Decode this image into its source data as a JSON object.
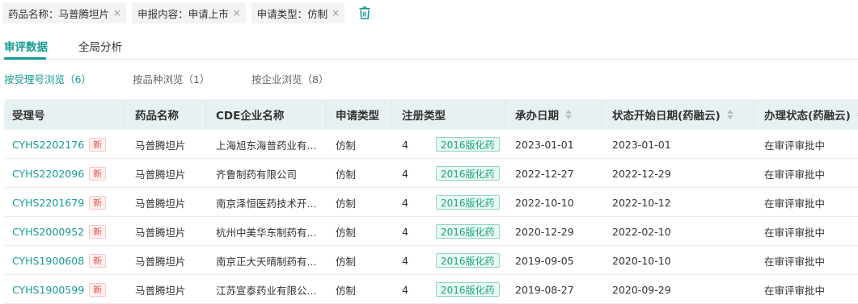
{
  "filters": [
    {
      "label": "药品名称：马普腾坦片"
    },
    {
      "label": "申报内容：申请上市"
    },
    {
      "label": "申请类型：仿制"
    }
  ],
  "icons": {
    "close": "×",
    "trash": "trash-icon",
    "sort": "sort-icon"
  },
  "tabs": [
    {
      "label": "审评数据",
      "active": true
    },
    {
      "label": "全局分析",
      "active": false
    }
  ],
  "subtabs": [
    {
      "label": "按受理号浏览（6）",
      "active": true
    },
    {
      "label": "按品种浏览（1）",
      "active": false
    },
    {
      "label": "按企业浏览（8）",
      "active": false
    }
  ],
  "table": {
    "headers": [
      "受理号",
      "药品名称",
      "CDE企业名称",
      "申请类型",
      "注册类型",
      "承办日期",
      "状态开始日期(药融云)",
      "办理状态(药融云)"
    ],
    "new_badge": "新",
    "rows": [
      {
        "id": "CYHS2202176",
        "drug": "马普腾坦片",
        "company": "上海旭东海普药业有...",
        "apply_type": "仿制",
        "reg_num": "4",
        "reg_badge": "2016版化药",
        "accept_date": "2023-01-01",
        "status_date": "2023-01-01",
        "status": "在审评审批中"
      },
      {
        "id": "CYHS2202096",
        "drug": "马普腾坦片",
        "company": "齐鲁制药有限公司",
        "apply_type": "仿制",
        "reg_num": "4",
        "reg_badge": "2016版化药",
        "accept_date": "2022-12-27",
        "status_date": "2022-12-29",
        "status": "在审评审批中"
      },
      {
        "id": "CYHS2201679",
        "drug": "马普腾坦片",
        "company": "南京泽恒医药技术开...",
        "apply_type": "仿制",
        "reg_num": "4",
        "reg_badge": "2016版化药",
        "accept_date": "2022-10-10",
        "status_date": "2022-10-12",
        "status": "在审评审批中"
      },
      {
        "id": "CYHS2000952",
        "drug": "马普腾坦片",
        "company": "杭州中美华东制药有...",
        "apply_type": "仿制",
        "reg_num": "4",
        "reg_badge": "2016版化药",
        "accept_date": "2020-12-29",
        "status_date": "2022-02-10",
        "status": "在审评审批中"
      },
      {
        "id": "CYHS1900608",
        "drug": "马普腾坦片",
        "company": "南京正大天晴制药有...",
        "apply_type": "仿制",
        "reg_num": "4",
        "reg_badge": "2016版化药",
        "accept_date": "2019-09-05",
        "status_date": "2020-10-10",
        "status": "在审评审批中"
      },
      {
        "id": "CYHS1900599",
        "drug": "马普腾坦片",
        "company": "江苏宣泰药业有限公...",
        "apply_type": "仿制",
        "reg_num": "4",
        "reg_badge": "2016版化药",
        "accept_date": "2019-08-27",
        "status_date": "2020-09-29",
        "status": "在审评审批中"
      }
    ]
  },
  "colors": {
    "accent": "#159b93",
    "header_bg": "#e8f1f2",
    "new_badge": "#e5534b",
    "reg_badge": "#1aa37b"
  }
}
